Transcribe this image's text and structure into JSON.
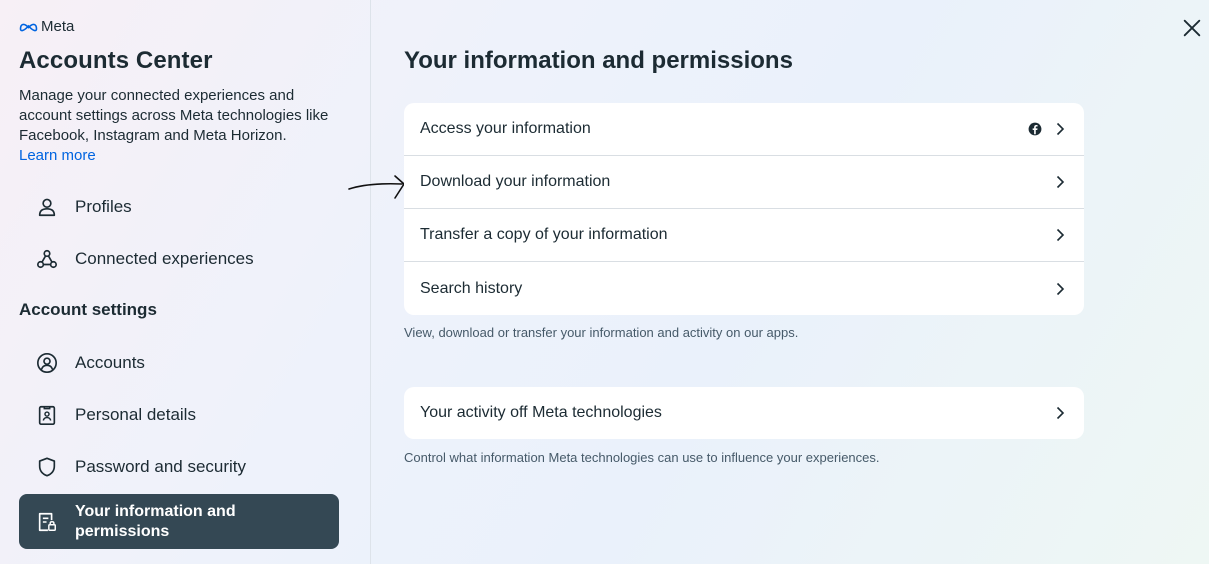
{
  "brand": {
    "name": "Meta"
  },
  "sidebar": {
    "title": "Accounts Center",
    "description": "Manage your connected experiences and account settings across Meta technologies like Facebook, Instagram and Meta Horizon.",
    "learn_more": "Learn more",
    "items": [
      {
        "label": "Profiles",
        "icon": "person-icon"
      },
      {
        "label": "Connected experiences",
        "icon": "connected-icon"
      }
    ],
    "settings_title": "Account settings",
    "settings_items": [
      {
        "label": "Accounts",
        "icon": "account-circle-icon"
      },
      {
        "label": "Personal details",
        "icon": "id-card-icon"
      },
      {
        "label": "Password and security",
        "icon": "shield-icon"
      },
      {
        "label": "Your information and permissions",
        "icon": "info-lock-icon",
        "active": true
      }
    ]
  },
  "main": {
    "title": "Your information and permissions",
    "card1": {
      "rows": [
        {
          "label": "Access your information",
          "icon": "facebook-icon"
        },
        {
          "label": "Download your information"
        },
        {
          "label": "Transfer a copy of your information"
        },
        {
          "label": "Search history"
        }
      ],
      "note": "View, download or transfer your information and activity on our apps."
    },
    "card2": {
      "rows": [
        {
          "label": "Your activity off Meta technologies"
        }
      ],
      "note": "Control what information Meta technologies can use to influence your experiences."
    }
  },
  "colors": {
    "accent": "#0064e0",
    "active_bg": "#344854",
    "text": "#1c2b33"
  }
}
